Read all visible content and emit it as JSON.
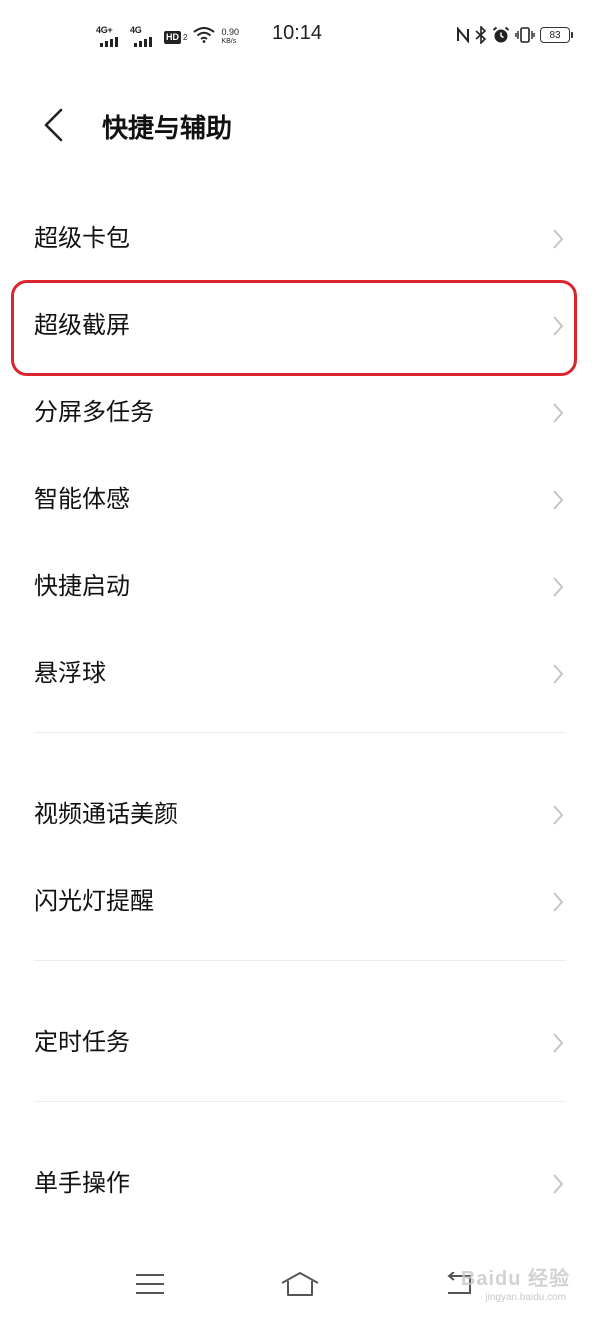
{
  "status_bar": {
    "sim1_network": "4G+",
    "sim2_network": "4G",
    "hd_label": "HD",
    "hd_sub": "2",
    "speed_value": "0.90",
    "speed_unit": "KB/s",
    "time": "10:14",
    "battery_level": "83"
  },
  "header": {
    "title": "快捷与辅助"
  },
  "menu": {
    "items": [
      {
        "label": "超级卡包"
      },
      {
        "label": "超级截屏"
      },
      {
        "label": "分屏多任务"
      },
      {
        "label": "智能体感"
      },
      {
        "label": "快捷启动"
      },
      {
        "label": "悬浮球"
      },
      {
        "label": "视频通话美颜"
      },
      {
        "label": "闪光灯提醒"
      },
      {
        "label": "定时任务"
      },
      {
        "label": "单手操作"
      }
    ],
    "highlighted_item": "超级截屏"
  },
  "colors": {
    "highlight": "#d9262e",
    "chevron": "#c4c4c4"
  },
  "watermark": {
    "brand": "Baidu 经验",
    "url": "jingyan.baidu.com"
  }
}
